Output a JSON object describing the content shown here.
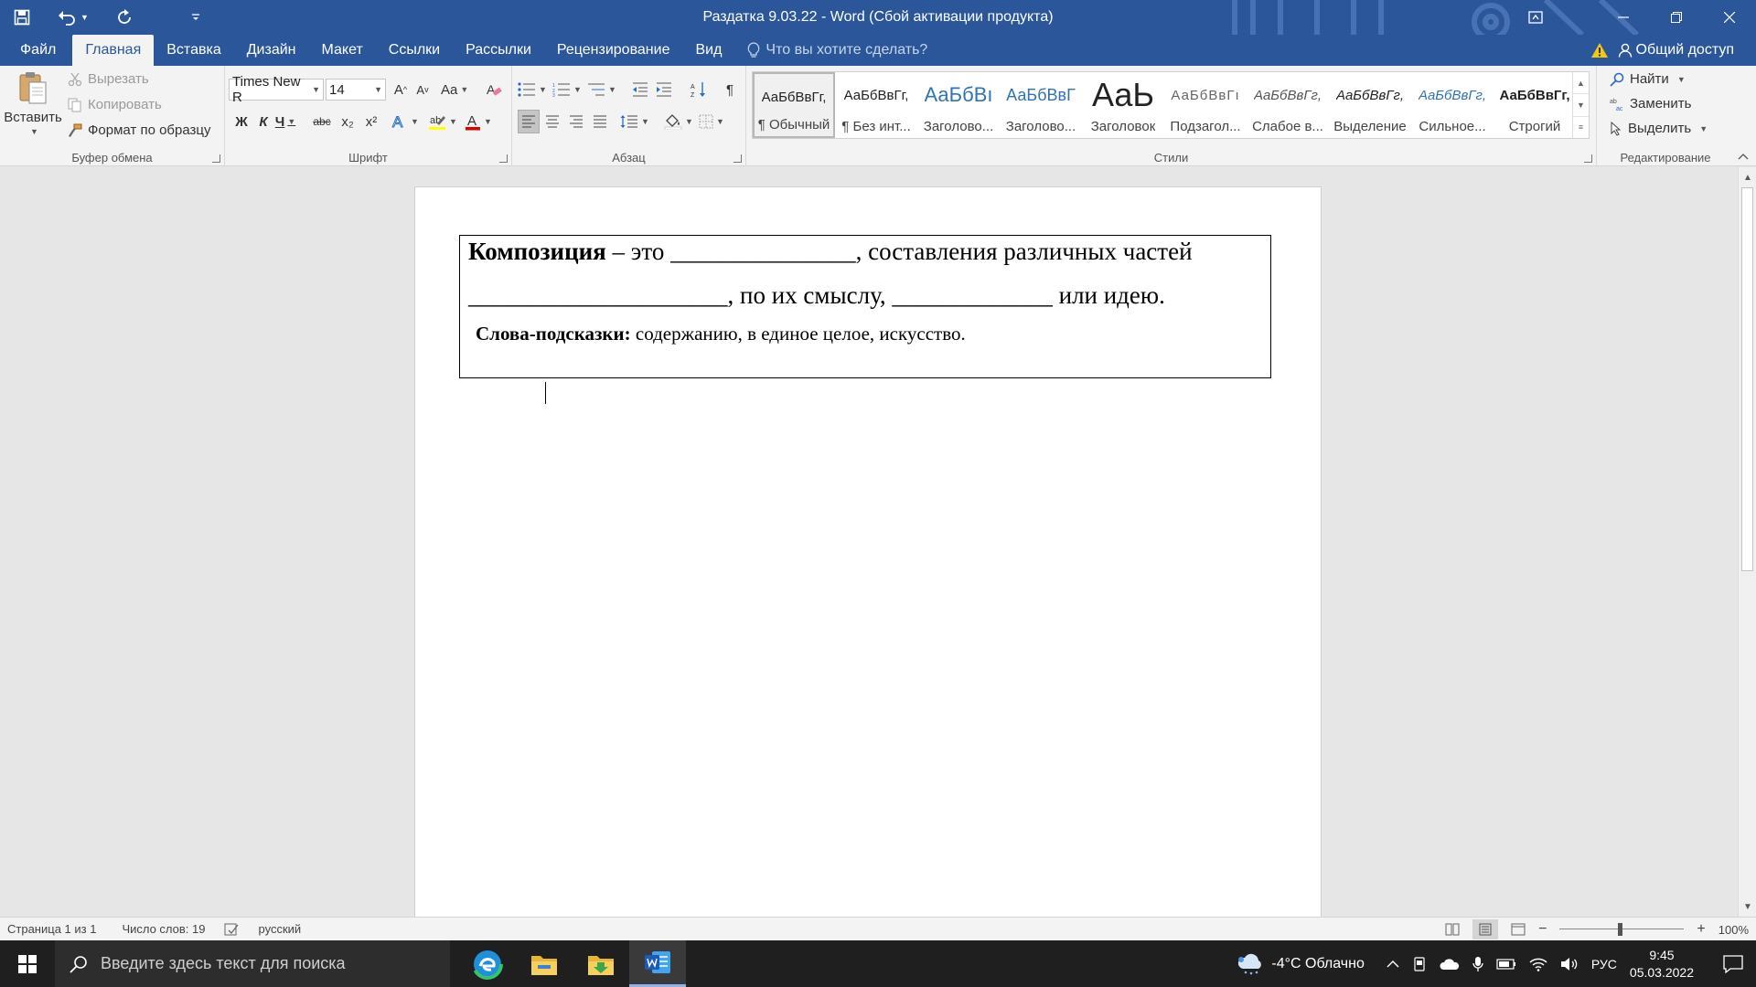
{
  "titlebar": {
    "title": "Раздатка 9.03.22 - Word (Сбой активации продукта)",
    "colors": {
      "ribbon": "#2b579a"
    }
  },
  "tabs": {
    "items": [
      "Файл",
      "Главная",
      "Вставка",
      "Дизайн",
      "Макет",
      "Ссылки",
      "Рассылки",
      "Рецензирование",
      "Вид"
    ],
    "active": "Главная",
    "tell_me": "Что вы хотите сделать?",
    "share": "Общий доступ"
  },
  "clipboard": {
    "paste": "Вставить",
    "cut": "Вырезать",
    "copy": "Копировать",
    "format_painter": "Формат по образцу",
    "label": "Буфер обмена"
  },
  "font": {
    "name": "Times New R",
    "size": "14",
    "change_case": "Aa",
    "bold": "Ж",
    "italic": "К",
    "underline": "Ч",
    "strike": "abc",
    "subscript": "x₂",
    "superscript": "x²",
    "label": "Шрифт"
  },
  "paragraph": {
    "label": "Абзац",
    "pilcrow": "¶"
  },
  "styles": {
    "label": "Стили",
    "items": [
      {
        "preview": "АаБбВвГг,",
        "name": "¶ Обычный"
      },
      {
        "preview": "АаБбВвГг,",
        "name": "¶ Без инт..."
      },
      {
        "preview": "АаБбВı",
        "name": "Заголово..."
      },
      {
        "preview": "АаБбВвГ",
        "name": "Заголово..."
      },
      {
        "preview": "АаЬ",
        "name": "Заголовок"
      },
      {
        "preview": "АаБбВвГı",
        "name": "Подзагол..."
      },
      {
        "preview": "АаБбВвГг,",
        "name": "Слабое в..."
      },
      {
        "preview": "АаБбВвГг,",
        "name": "Выделение"
      },
      {
        "preview": "АаБбВвГг,",
        "name": "Сильное..."
      },
      {
        "preview": "АаБбВвГг,",
        "name": "Строгий"
      }
    ]
  },
  "editing": {
    "find": "Найти",
    "replace": "Заменить",
    "select": "Выделить",
    "label": "Редактирование"
  },
  "document": {
    "term": "Композиция",
    "line1_rest": " – это _______________, составления различных частей",
    "line2": "_____________________, по их смыслу, _____________ или идею.",
    "hint_label": "Слова-подсказки:",
    "hint_text": " содержанию, в единое целое, искусство."
  },
  "status": {
    "page": "Страница 1 из 1",
    "words": "Число слов: 19",
    "language": "русский",
    "zoom": "100%"
  },
  "taskbar": {
    "search_placeholder": "Введите здесь текст для поиска",
    "weather": "-4°C  Облачно",
    "lang": "РУС",
    "time": "9:45",
    "date": "05.03.2022"
  }
}
